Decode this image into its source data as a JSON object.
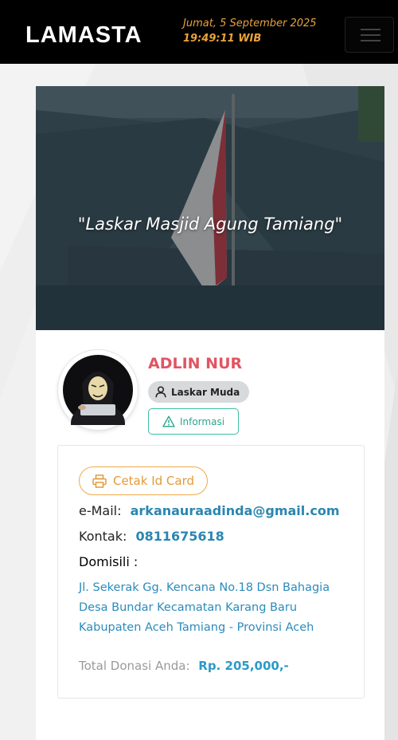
{
  "navbar": {
    "logo": "LAMASTA",
    "date": "Jumat, 5 September 2025",
    "time": "19:49:11 WIB",
    "menu_icon": "hamburger-icon"
  },
  "hero": {
    "quote": "\"Laskar Masjid Agung Tamiang\""
  },
  "profile": {
    "name": "ADLIN NUR",
    "role": "Laskar Muda",
    "role_icon": "user-icon",
    "info_label": "Informasi",
    "info_icon": "warning-triangle-icon"
  },
  "details": {
    "print_label": "Cetak Id Card",
    "print_icon": "printer-icon",
    "email_label": "e-Mail:",
    "email_value": "arkanauraadinda@gmail.com",
    "contact_label": "Kontak:",
    "contact_value": "0811675618",
    "domicile_label": "Domisili :",
    "address": "Jl. Sekerak Gg. Kencana No.18 Dsn Bahagia Desa  Bundar  Kecamatan  Karang Baru Kabupaten Aceh Tamiang - Provinsi  Aceh",
    "donation_label": "Total Donasi Anda:",
    "donation_value": "Rp. 205,000,-"
  },
  "colors": {
    "accent_name": "#e05563",
    "link_blue": "#2b86b0",
    "info_green": "#3bbfa5",
    "print_orange": "#f0a94a",
    "datetime_orange": "#e8a23c"
  }
}
